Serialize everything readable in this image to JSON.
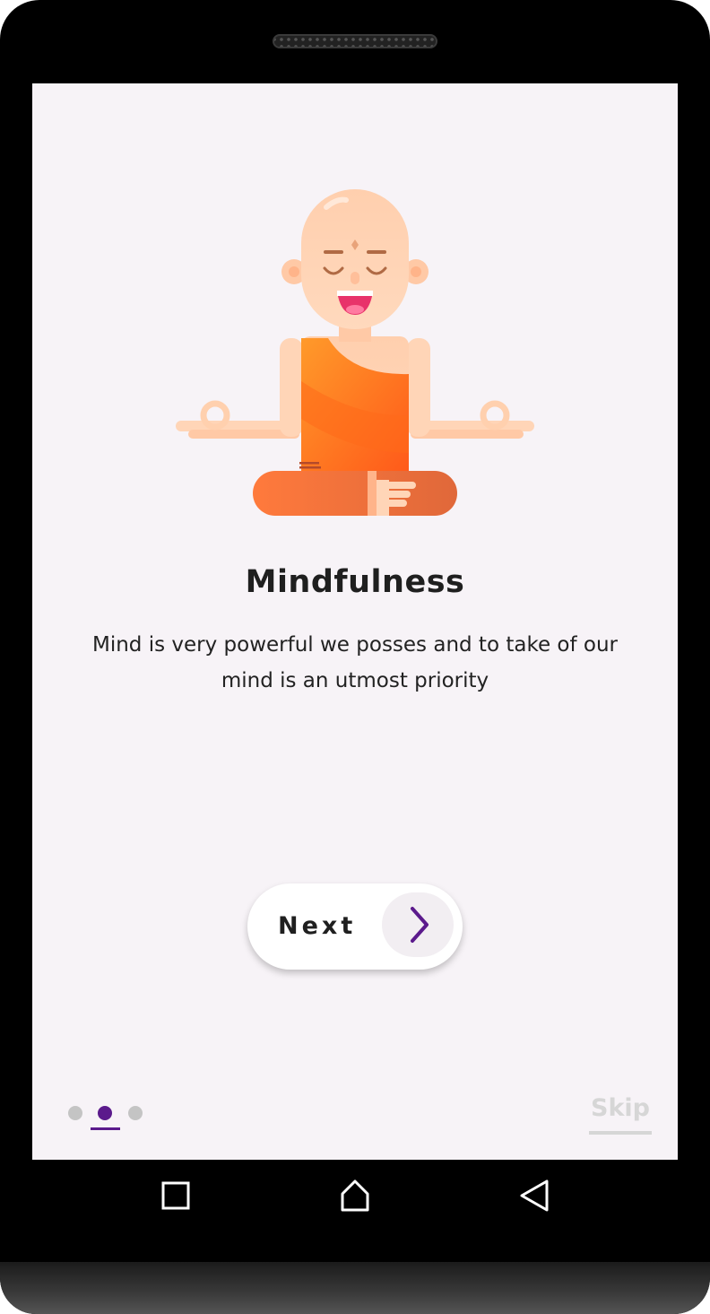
{
  "onboarding": {
    "title": "Mindfulness",
    "description": "Mind is very powerful we posses and to take of our mind is an utmost priority",
    "next_label": "Next",
    "skip_label": "Skip",
    "page_indicator": {
      "total": 3,
      "current": 2
    }
  },
  "icons": {
    "illustration": "meditating-monk-illustration",
    "next": "chevron-right-icon",
    "recents": "square-icon",
    "home": "home-icon",
    "back": "triangle-back-icon"
  },
  "colors": {
    "accent": "#5b1a8c",
    "background": "#f7f3f7",
    "text": "#1f1f1f",
    "inactive_dot": "#c4c4c4",
    "skip": "#d6d6d6",
    "robe": "#ff7a1a"
  }
}
